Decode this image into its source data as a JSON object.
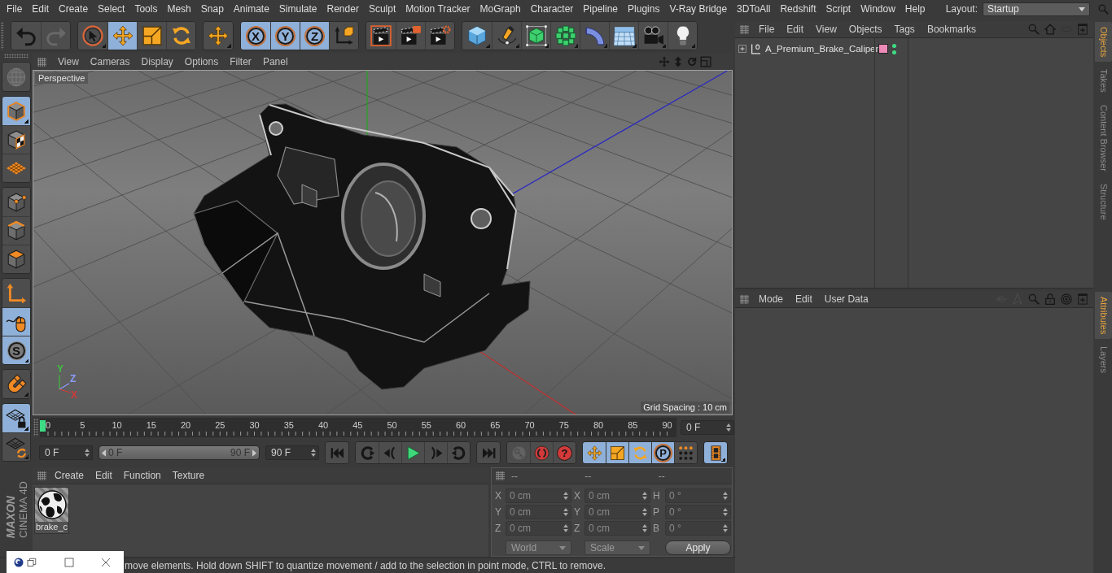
{
  "menu_bar": {
    "items": [
      "File",
      "Edit",
      "Create",
      "Select",
      "Tools",
      "Mesh",
      "Snap",
      "Animate",
      "Simulate",
      "Render",
      "Sculpt",
      "Motion Tracker",
      "MoGraph",
      "Character",
      "Pipeline",
      "Plugins",
      "V-Ray Bridge",
      "3DToAll",
      "Redshift",
      "Script",
      "Window",
      "Help"
    ],
    "layout_label": "Layout:",
    "layout_value": "Startup"
  },
  "toolbar": [
    [
      {
        "kind": "undo",
        "selected": false,
        "disabled": false,
        "submenu": false
      },
      {
        "kind": "redo",
        "selected": false,
        "disabled": true,
        "submenu": false
      }
    ],
    [
      {
        "kind": "select",
        "selected": false,
        "disabled": false,
        "submenu": true
      },
      {
        "kind": "move",
        "selected": true,
        "disabled": false,
        "submenu": false
      },
      {
        "kind": "scale",
        "selected": false,
        "disabled": false,
        "submenu": false
      },
      {
        "kind": "rotate",
        "selected": false,
        "disabled": false,
        "submenu": false
      }
    ],
    [
      {
        "kind": "move",
        "selected": false,
        "disabled": false,
        "submenu": true
      }
    ],
    [
      {
        "kind": "axis_lock",
        "label": "X",
        "selected": true,
        "disabled": false,
        "submenu": false
      },
      {
        "kind": "axis_lock",
        "label": "Y",
        "selected": true,
        "disabled": false,
        "submenu": false
      },
      {
        "kind": "axis_lock",
        "label": "Z",
        "selected": true,
        "disabled": false,
        "submenu": false
      },
      {
        "kind": "coords",
        "selected": false,
        "disabled": false,
        "submenu": false
      }
    ],
    [
      {
        "kind": "render_view",
        "selected": false,
        "disabled": false,
        "submenu": false
      },
      {
        "kind": "render_pv",
        "selected": false,
        "disabled": false,
        "submenu": false
      },
      {
        "kind": "render_settings",
        "selected": false,
        "disabled": false,
        "submenu": false
      }
    ],
    [
      {
        "kind": "cube",
        "selected": false,
        "disabled": false,
        "submenu": true
      },
      {
        "kind": "pen",
        "selected": false,
        "disabled": false,
        "submenu": true
      },
      {
        "kind": "subdivision",
        "selected": false,
        "disabled": false,
        "submenu": true
      },
      {
        "kind": "cloner",
        "selected": false,
        "disabled": false,
        "submenu": true
      },
      {
        "kind": "deformer",
        "selected": false,
        "disabled": false,
        "submenu": true
      },
      {
        "kind": "floor",
        "selected": false,
        "disabled": false,
        "submenu": true
      },
      {
        "kind": "camera",
        "selected": false,
        "disabled": false,
        "submenu": true
      },
      {
        "kind": "light",
        "selected": false,
        "disabled": false,
        "submenu": true
      }
    ]
  ],
  "tools": [
    [
      {
        "kind": "make_editable",
        "selected": false,
        "disabled": true,
        "submenu": false
      }
    ],
    [
      {
        "kind": "model",
        "selected": true,
        "disabled": false,
        "submenu": true
      },
      {
        "kind": "texture",
        "selected": false,
        "disabled": false,
        "submenu": false
      },
      {
        "kind": "workplane",
        "selected": false,
        "disabled": false,
        "submenu": false
      }
    ],
    [
      {
        "kind": "points",
        "selected": false,
        "disabled": false,
        "submenu": false
      },
      {
        "kind": "edges",
        "selected": false,
        "disabled": false,
        "submenu": false
      },
      {
        "kind": "polygons",
        "selected": false,
        "disabled": false,
        "submenu": false
      }
    ],
    [
      {
        "kind": "axis_mode",
        "selected": false,
        "disabled": false,
        "submenu": false
      },
      {
        "kind": "tweak",
        "selected": true,
        "disabled": false,
        "submenu": false
      },
      {
        "kind": "solo",
        "label": "S",
        "selected": true,
        "disabled": false,
        "submenu": true
      }
    ],
    [
      {
        "kind": "snap",
        "selected": false,
        "disabled": false,
        "submenu": true
      }
    ],
    [
      {
        "kind": "lock_workplane",
        "selected": true,
        "disabled": false,
        "submenu": true
      },
      {
        "kind": "planar_workplane",
        "selected": false,
        "disabled": false,
        "submenu": true
      }
    ]
  ],
  "logo": {
    "brand": "MAXON",
    "product": "CINEMA 4D"
  },
  "viewport": {
    "menu": [
      "View",
      "Cameras",
      "Display",
      "Options",
      "Filter",
      "Panel"
    ],
    "nav": [
      {
        "kind": "pan"
      },
      {
        "kind": "zoom"
      },
      {
        "kind": "orbit"
      },
      {
        "kind": "maximize"
      }
    ],
    "camera": "Perspective",
    "grid_spacing": "Grid Spacing : 10 cm",
    "axes": [
      {
        "label": "Y",
        "color": "#3fbf3f"
      },
      {
        "label": "Z",
        "color": "#8c9cff"
      },
      {
        "label": "X",
        "color": "#d03a3a"
      }
    ]
  },
  "timeline": {
    "ticks": [
      "0",
      "5",
      "10",
      "15",
      "20",
      "25",
      "30",
      "35",
      "40",
      "45",
      "50",
      "55",
      "60",
      "65",
      "70",
      "75",
      "80",
      "85",
      "90"
    ],
    "level": 0,
    "frame": "0 F"
  },
  "transport": {
    "start": "0 F",
    "range": {
      "start": "0 F",
      "end": "90 F",
      "level": 1
    },
    "end": "90 F",
    "groups": [
      [
        {
          "kind": "first_frame",
          "selected": false,
          "disabled": false,
          "submenu": false
        }
      ],
      [
        {
          "kind": "prev_key",
          "selected": false,
          "disabled": false,
          "submenu": false
        },
        {
          "kind": "prev_frame",
          "selected": false,
          "disabled": false,
          "submenu": false
        },
        {
          "kind": "play",
          "selected": false,
          "disabled": false,
          "submenu": false
        },
        {
          "kind": "next_frame",
          "selected": false,
          "disabled": false,
          "submenu": false
        },
        {
          "kind": "next_key",
          "selected": false,
          "disabled": false,
          "submenu": false
        }
      ],
      [
        {
          "kind": "last_frame",
          "selected": false,
          "disabled": false,
          "submenu": false
        }
      ],
      [
        {
          "kind": "record_key",
          "selected": false,
          "disabled": true,
          "submenu": false
        },
        {
          "kind": "autokey",
          "selected": false,
          "disabled": false,
          "submenu": false
        },
        {
          "kind": "key_selection",
          "label": "?",
          "selected": false,
          "disabled": false,
          "submenu": false
        }
      ],
      [
        {
          "kind": "key_position",
          "selected": true,
          "disabled": false,
          "submenu": false
        },
        {
          "kind": "key_scale",
          "selected": true,
          "disabled": false,
          "submenu": false
        },
        {
          "kind": "key_rotation",
          "selected": true,
          "disabled": false,
          "submenu": false
        },
        {
          "kind": "key_parameter",
          "label": "P",
          "selected": true,
          "disabled": false,
          "submenu": false
        },
        {
          "kind": "key_point_level",
          "selected": false,
          "disabled": false,
          "submenu": false
        }
      ],
      [
        {
          "kind": "timeline_window",
          "selected": true,
          "disabled": false,
          "submenu": true
        }
      ]
    ]
  },
  "material_manager": {
    "menu": [
      "Create",
      "Edit",
      "Function",
      "Texture"
    ],
    "materials": [
      {
        "name": "brake_c"
      }
    ]
  },
  "coordinates": {
    "headers": [
      "--",
      "--",
      "--"
    ],
    "rows": [
      {
        "labels": [
          "X",
          "X",
          "H"
        ],
        "values": [
          "0 cm",
          "0 cm",
          "0 °"
        ]
      },
      {
        "labels": [
          "Y",
          "Y",
          "P"
        ],
        "values": [
          "0 cm",
          "0 cm",
          "0 °"
        ]
      },
      {
        "labels": [
          "Z",
          "Z",
          "B"
        ],
        "values": [
          "0 cm",
          "0 cm",
          "0 °"
        ]
      }
    ],
    "dropdowns": [
      "World",
      "Scale"
    ],
    "apply": "Apply"
  },
  "status_bar": "move elements. Hold down SHIFT to quantize movement / add to the selection in point mode, CTRL to remove.",
  "minimized_window": {
    "buttons": [
      {
        "kind": "app_logo"
      },
      {
        "kind": "restore"
      },
      {
        "kind": "win_maximize"
      },
      {
        "kind": "close"
      }
    ]
  },
  "object_manager": {
    "menu": [
      "File",
      "Edit",
      "View",
      "Objects",
      "Tags",
      "Bookmarks"
    ],
    "tools": [
      {
        "kind": "search",
        "disabled": false
      },
      {
        "kind": "home",
        "disabled": false
      },
      {
        "kind": "oval",
        "disabled": true
      },
      {
        "kind": "new_panel",
        "disabled": false
      }
    ],
    "objects": [
      {
        "name": "A_Premium_Brake_Caliper",
        "expanded": false,
        "color": "#ee8ab8",
        "editor_visible": true,
        "render_visible": true
      }
    ]
  },
  "attributes": {
    "menu": [
      "Mode",
      "Edit",
      "User Data"
    ],
    "tools": [
      {
        "kind": "back",
        "disabled": true
      },
      {
        "kind": "up",
        "disabled": true
      },
      {
        "kind": "search",
        "disabled": false
      },
      {
        "kind": "lock",
        "disabled": false
      },
      {
        "kind": "target",
        "disabled": false
      },
      {
        "kind": "new_panel",
        "disabled": false
      }
    ]
  },
  "side_tabs": {
    "upper": [
      {
        "label": "Objects",
        "selected": true
      },
      {
        "label": "Takes",
        "selected": false
      },
      {
        "label": "Content Browser",
        "selected": false
      },
      {
        "label": "Structure",
        "selected": false
      }
    ],
    "lower": [
      {
        "label": "Attributes",
        "selected": true
      },
      {
        "label": "Layers",
        "selected": false
      }
    ]
  }
}
